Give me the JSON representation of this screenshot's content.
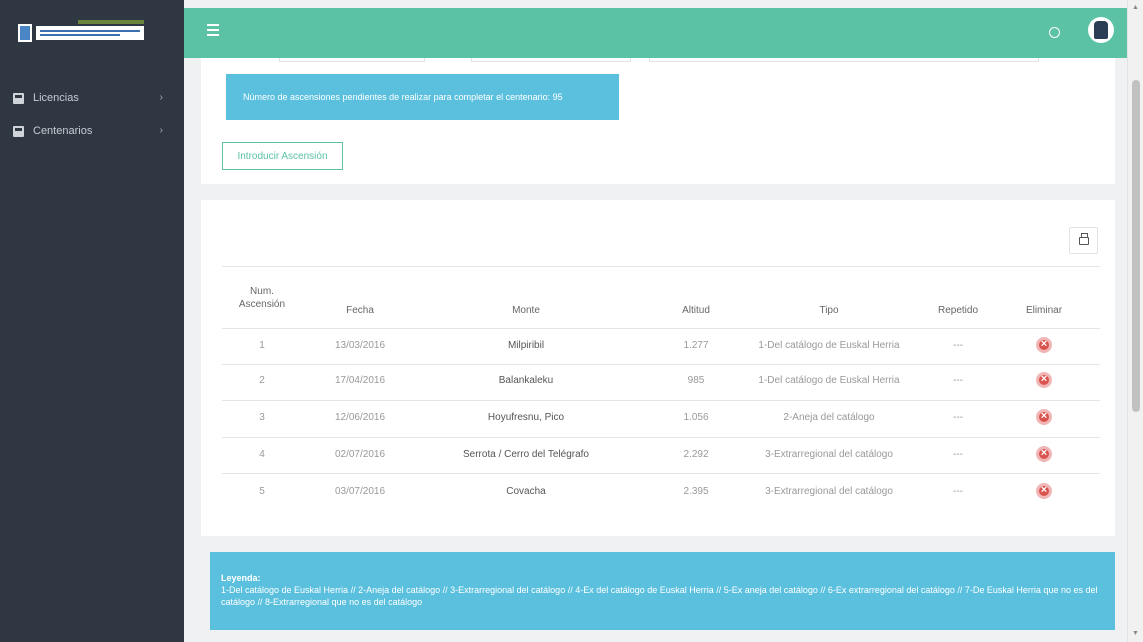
{
  "sidebar": {
    "items": [
      {
        "label": "Licencias",
        "icon": "id-card-icon"
      },
      {
        "label": "Centenarios",
        "icon": "calendar-icon"
      }
    ]
  },
  "topbar": {
    "accent": "#5bc2a6"
  },
  "alert": {
    "text": "Número de ascensiones pendientes de realizar para completar el centenario: 95"
  },
  "buttons": {
    "introducir": "Introducir Ascensión"
  },
  "table": {
    "headers": {
      "num": "Num. Ascensión",
      "fecha": "Fecha",
      "monte": "Monte",
      "altitud": "Altitud",
      "tipo": "Tipo",
      "repetido": "Repetido",
      "eliminar": "Eliminar"
    },
    "rows": [
      {
        "num": "1",
        "fecha": "13/03/2016",
        "monte": "Milpiribil",
        "altitud": "1.277",
        "tipo": "1-Del catálogo de Euskal Herria",
        "repetido": "---"
      },
      {
        "num": "2",
        "fecha": "17/04/2016",
        "monte": "Balankaleku",
        "altitud": "985",
        "tipo": "1-Del catálogo de Euskal Herria",
        "repetido": "---"
      },
      {
        "num": "3",
        "fecha": "12/06/2016",
        "monte": "Hoyufresnu, Pico",
        "altitud": "1.056",
        "tipo": "2-Aneja del catálogo",
        "repetido": "---"
      },
      {
        "num": "4",
        "fecha": "02/07/2016",
        "monte": "Serrota / Cerro del Telégrafo",
        "altitud": "2.292",
        "tipo": "3-Extrarregional del catálogo",
        "repetido": "---"
      },
      {
        "num": "5",
        "fecha": "03/07/2016",
        "monte": "Covacha",
        "altitud": "2.395",
        "tipo": "3-Extrarregional del catálogo",
        "repetido": "---"
      }
    ]
  },
  "legend": {
    "title": "Leyenda:",
    "text": "1-Del catálogo de Euskal Herria // 2-Aneja del catálogo // 3-Extrarregional del catálogo // 4-Ex del catálogo de Euskal Herria // 5-Ex aneja del catálogo // 6-Ex extrarregional del catálogo // 7-De Euskal Herria que no es del catálogo // 8-Extrarregional que no es del catálogo"
  }
}
